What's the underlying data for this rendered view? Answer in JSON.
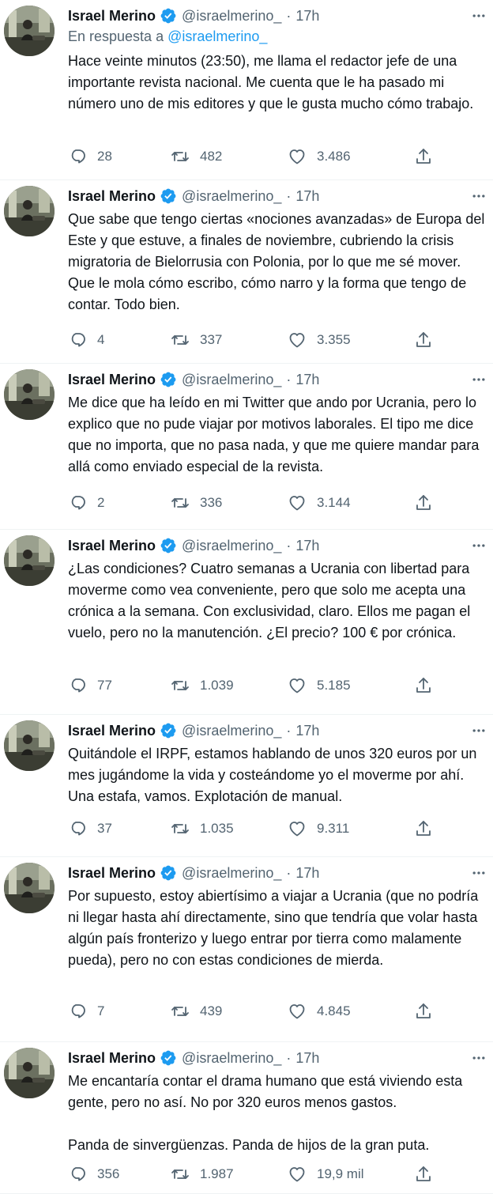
{
  "colors": {
    "accent": "#1d9bf0",
    "text": "#0f1419",
    "muted": "#536471",
    "divider": "#eff3f4"
  },
  "icons": {
    "verified": "verified-badge-icon",
    "more": "more-dots-icon",
    "reply": "reply-icon",
    "retweet": "retweet-icon",
    "like": "heart-icon",
    "share": "share-icon"
  },
  "tweets": [
    {
      "name": "Israel Merino",
      "handle": "@israelmerino_",
      "dot": "·",
      "time": "17h",
      "reply_label": "En respuesta a",
      "reply_handle": "@israelmerino_",
      "text": [
        "Hace veinte minutos (23:50), me llama el redactor jefe de una importante revista nacional. Me cuenta que le ha pasado mi número uno de mis editores y que le gusta mucho cómo trabajo."
      ],
      "replies": "28",
      "retweets": "482",
      "likes": "3.486"
    },
    {
      "name": "Israel Merino",
      "handle": "@israelmerino_",
      "dot": "·",
      "time": "17h",
      "text": [
        "Que sabe que tengo ciertas «nociones avanzadas» de Europa del Este y que estuve, a finales de noviembre, cubriendo la crisis migratoria de Bielorrusia con Polonia, por lo que me sé mover. Que le mola cómo escribo, cómo narro y la forma que tengo de contar. Todo bien."
      ],
      "replies": "4",
      "retweets": "337",
      "likes": "3.355"
    },
    {
      "name": "Israel Merino",
      "handle": "@israelmerino_",
      "dot": "·",
      "time": "17h",
      "text": [
        "Me dice que ha leído en mi Twitter que ando por Ucrania, pero lo explico que no pude viajar por motivos laborales. El tipo me dice que no importa, que no pasa nada, y que me quiere mandar para allá como enviado especial de la revista."
      ],
      "replies": "2",
      "retweets": "336",
      "likes": "3.144"
    },
    {
      "name": "Israel Merino",
      "handle": "@israelmerino_",
      "dot": "·",
      "time": "17h",
      "text": [
        "¿Las condiciones? Cuatro semanas a Ucrania con libertad para moverme como vea conveniente, pero que solo me acepta una crónica a la semana. Con exclusividad, claro. Ellos me pagan el vuelo, pero no la manutención. ¿El precio? 100 € por crónica."
      ],
      "replies": "77",
      "retweets": "1.039",
      "likes": "5.185"
    },
    {
      "name": "Israel Merino",
      "handle": "@israelmerino_",
      "dot": "·",
      "time": "17h",
      "text": [
        "Quitándole el IRPF, estamos hablando de unos 320 euros por un mes jugándome la vida y costeándome yo el moverme por ahí. Una estafa, vamos. Explotación de manual."
      ],
      "replies": "37",
      "retweets": "1.035",
      "likes": "9.311"
    },
    {
      "name": "Israel Merino",
      "handle": "@israelmerino_",
      "dot": "·",
      "time": "17h",
      "text": [
        "Por supuesto, estoy abiertísimo a viajar a Ucrania (que no podría ni llegar hasta ahí directamente, sino que tendría que volar hasta algún país fronterizo y luego entrar por tierra como malamente pueda), pero no con estas condiciones de mierda."
      ],
      "replies": "7",
      "retweets": "439",
      "likes": "4.845"
    },
    {
      "name": "Israel Merino",
      "handle": "@israelmerino_",
      "dot": "·",
      "time": "17h",
      "text": [
        "Me encantaría contar el drama humano que está viviendo esta gente, pero no así. No por 320 euros menos gastos.",
        "Panda de sinvergüenzas. Panda de hijos de la gran puta."
      ],
      "replies": "356",
      "retweets": "1.987",
      "likes": "19,9 mil"
    }
  ]
}
